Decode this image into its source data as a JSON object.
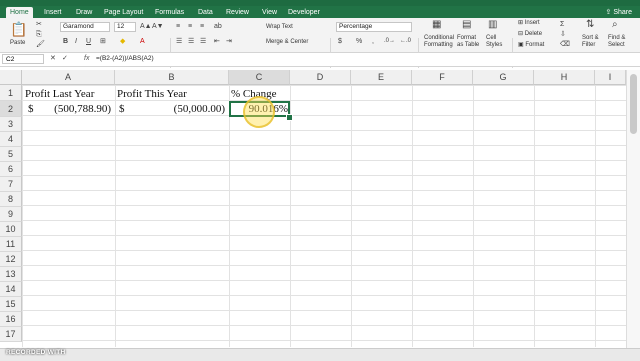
{
  "ribbon_tabs": [
    "Home",
    "Insert",
    "Draw",
    "Page Layout",
    "Formulas",
    "Data",
    "Review",
    "View",
    "Developer"
  ],
  "share_label": "Share",
  "clipboard": {
    "paste_label": "Paste"
  },
  "font": {
    "name": "Garamond",
    "size": "12"
  },
  "format_buttons": [
    "B",
    "I",
    "U"
  ],
  "alignment": {
    "wrap_text": "Wrap Text",
    "merge_center": "Merge & Center"
  },
  "number": {
    "format": "Percentage",
    "currency": "$",
    "percent": "%",
    "comma": ","
  },
  "styles": {
    "conditional": [
      "Conditional",
      "Formatting"
    ],
    "format_table": [
      "Format",
      "as Table"
    ],
    "cell_styles": [
      "Cell",
      "Styles"
    ]
  },
  "cells_group": {
    "insert": "Insert",
    "delete": "Delete",
    "format": "Format"
  },
  "editing": {
    "sort_filter": [
      "Sort &",
      "Filter"
    ],
    "find_select": [
      "Find &",
      "Select"
    ]
  },
  "formula_bar": {
    "cell_ref": "C2",
    "fx": "fx",
    "formula": "=(B2-(A2))/ABS(A2)"
  },
  "columns": [
    "A",
    "B",
    "C",
    "D",
    "E",
    "F",
    "G",
    "H",
    "I"
  ],
  "rows": [
    "1",
    "2",
    "3",
    "4",
    "5",
    "6",
    "7",
    "8",
    "9",
    "10",
    "11",
    "12",
    "13",
    "14",
    "15",
    "16",
    "17"
  ],
  "cells": {
    "A1": "Profit Last Year",
    "B1": "Profit This Year",
    "C1": "% Change",
    "A2_currency": "$",
    "A2_value": "(500,788.90)",
    "B2_currency": "$",
    "B2_value": "(50,000.00)",
    "C2": "90.016%"
  },
  "watermark": "RECORDED WITH",
  "accent_color": "#217346"
}
